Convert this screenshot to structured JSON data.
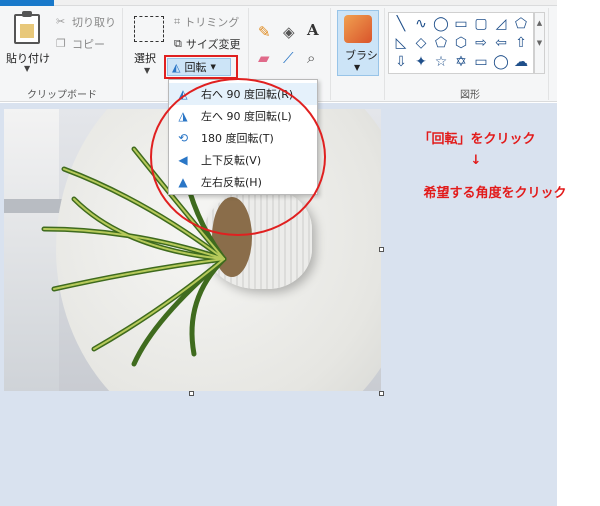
{
  "clipboard": {
    "paste_label": "貼り付け",
    "cut_label": "切り取り",
    "copy_label": "コピー",
    "group_label": "クリップボード"
  },
  "image": {
    "select_label": "選択",
    "crop_label": "トリミング",
    "resize_label": "サイズ変更",
    "rotate_label": "回転"
  },
  "tools": {
    "brush_label": "ブラシ"
  },
  "shapes": {
    "group_label": "図形",
    "items": [
      "╲",
      "∿",
      "◯",
      "▭",
      "▢",
      "◿",
      "⬠",
      "◺",
      "◇",
      "⬠",
      "⬡",
      "⇨",
      "⇦",
      "⇧",
      "⇩",
      "✦",
      "☆",
      "✡",
      "▭",
      "◯",
      "☁"
    ]
  },
  "rotate_menu": {
    "items": [
      {
        "icon": "rotate-right-90-icon",
        "glyph": "◭",
        "label": "右へ 90 度回転(R)"
      },
      {
        "icon": "rotate-left-90-icon",
        "glyph": "◮",
        "label": "左へ 90 度回転(L)"
      },
      {
        "icon": "rotate-180-icon",
        "glyph": "⟲",
        "label": "180 度回転(T)"
      },
      {
        "icon": "flip-vertical-icon",
        "glyph": "◀",
        "label": "上下反転(V)"
      },
      {
        "icon": "flip-horizontal-icon",
        "glyph": "▲",
        "label": "左右反転(H)"
      }
    ]
  },
  "annotation": {
    "line1": "「回転」をクリック",
    "arrow": "↓",
    "line2": "希望する角度をクリック"
  },
  "colors": {
    "highlight_red": "#e02020",
    "annotation_red": "#e21b1b",
    "menu_icon_blue": "#2a76c6"
  }
}
